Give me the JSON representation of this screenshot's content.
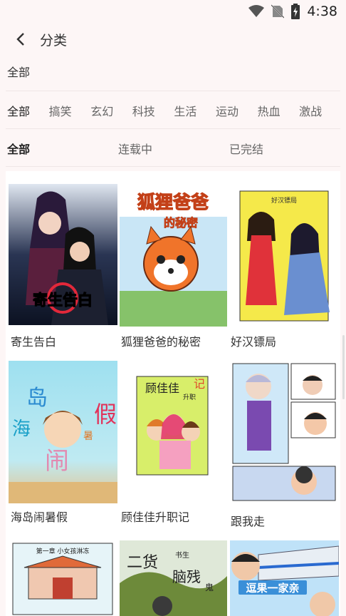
{
  "status_bar": {
    "time": "4:38"
  },
  "header": {
    "title": "分类"
  },
  "filter": {
    "section_label": "全部",
    "genres": [
      "全部",
      "搞笑",
      "玄幻",
      "科技",
      "生活",
      "运动",
      "热血",
      "激战"
    ],
    "status_tabs": [
      "全部",
      "连载中",
      "已完结"
    ]
  },
  "comics": [
    {
      "title": "寄生告白",
      "cover_text": "寄生告白",
      "accent": "#1b2540"
    },
    {
      "title": "狐狸爸爸的秘密",
      "cover_text": "狐狸爸爸的秘密",
      "accent": "#f0742a"
    },
    {
      "title": "好汉镖局",
      "cover_text": "好汉镖局",
      "accent": "#f5e94a"
    },
    {
      "title": "海岛闹暑假",
      "cover_text": "海岛闹暑假",
      "accent": "#7fd4e8"
    },
    {
      "title": "顾佳佳升职记",
      "cover_text": "顾佳佳升职记",
      "accent": "#d8ee6a"
    },
    {
      "title": "跟我走",
      "cover_text": "",
      "accent": "#9fd0f0"
    },
    {
      "title": "",
      "cover_text": "第一章 小女孩淋冻",
      "accent": "#d8f0f6"
    },
    {
      "title": "",
      "cover_text": "二货书生脑残鬼",
      "accent": "#6d8a3a"
    },
    {
      "title": "",
      "cover_text": "逗果一家亲",
      "accent": "#3a8fd8"
    }
  ]
}
